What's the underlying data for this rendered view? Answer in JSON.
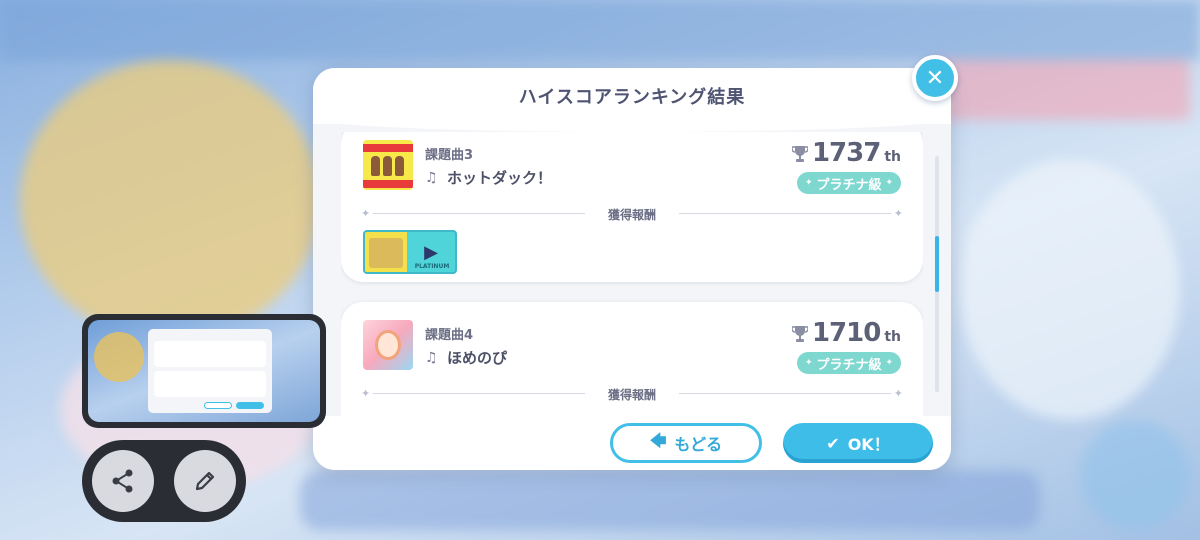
{
  "dialog": {
    "title": "ハイスコアランキング結果",
    "reward_heading": "獲得報酬",
    "back_label": "もどる",
    "ok_label": "OK！"
  },
  "songs": [
    {
      "label": "課題曲3",
      "name": "ホットダック！",
      "rank": "1737",
      "rank_suffix": "th",
      "grade": "プラチナ級",
      "jacket_icon": "hotdock-jacket"
    },
    {
      "label": "課題曲4",
      "name": "ほめのぴ",
      "rank": "1710",
      "rank_suffix": "th",
      "grade": "プラチナ級",
      "jacket_icon": "homenopi-jacket"
    }
  ],
  "reward_item": {
    "caption": "PLATINUM"
  },
  "colors": {
    "accent": "#42bfe6",
    "grade_badge": "#7fd8d0",
    "title_text": "#4f5473"
  },
  "icons": {
    "close": "close-icon",
    "back": "arrow-left-icon",
    "ok": "check-icon",
    "note": "music-note-icon",
    "trophy": "trophy-icon",
    "share": "share-icon",
    "edit": "pencil-icon"
  }
}
